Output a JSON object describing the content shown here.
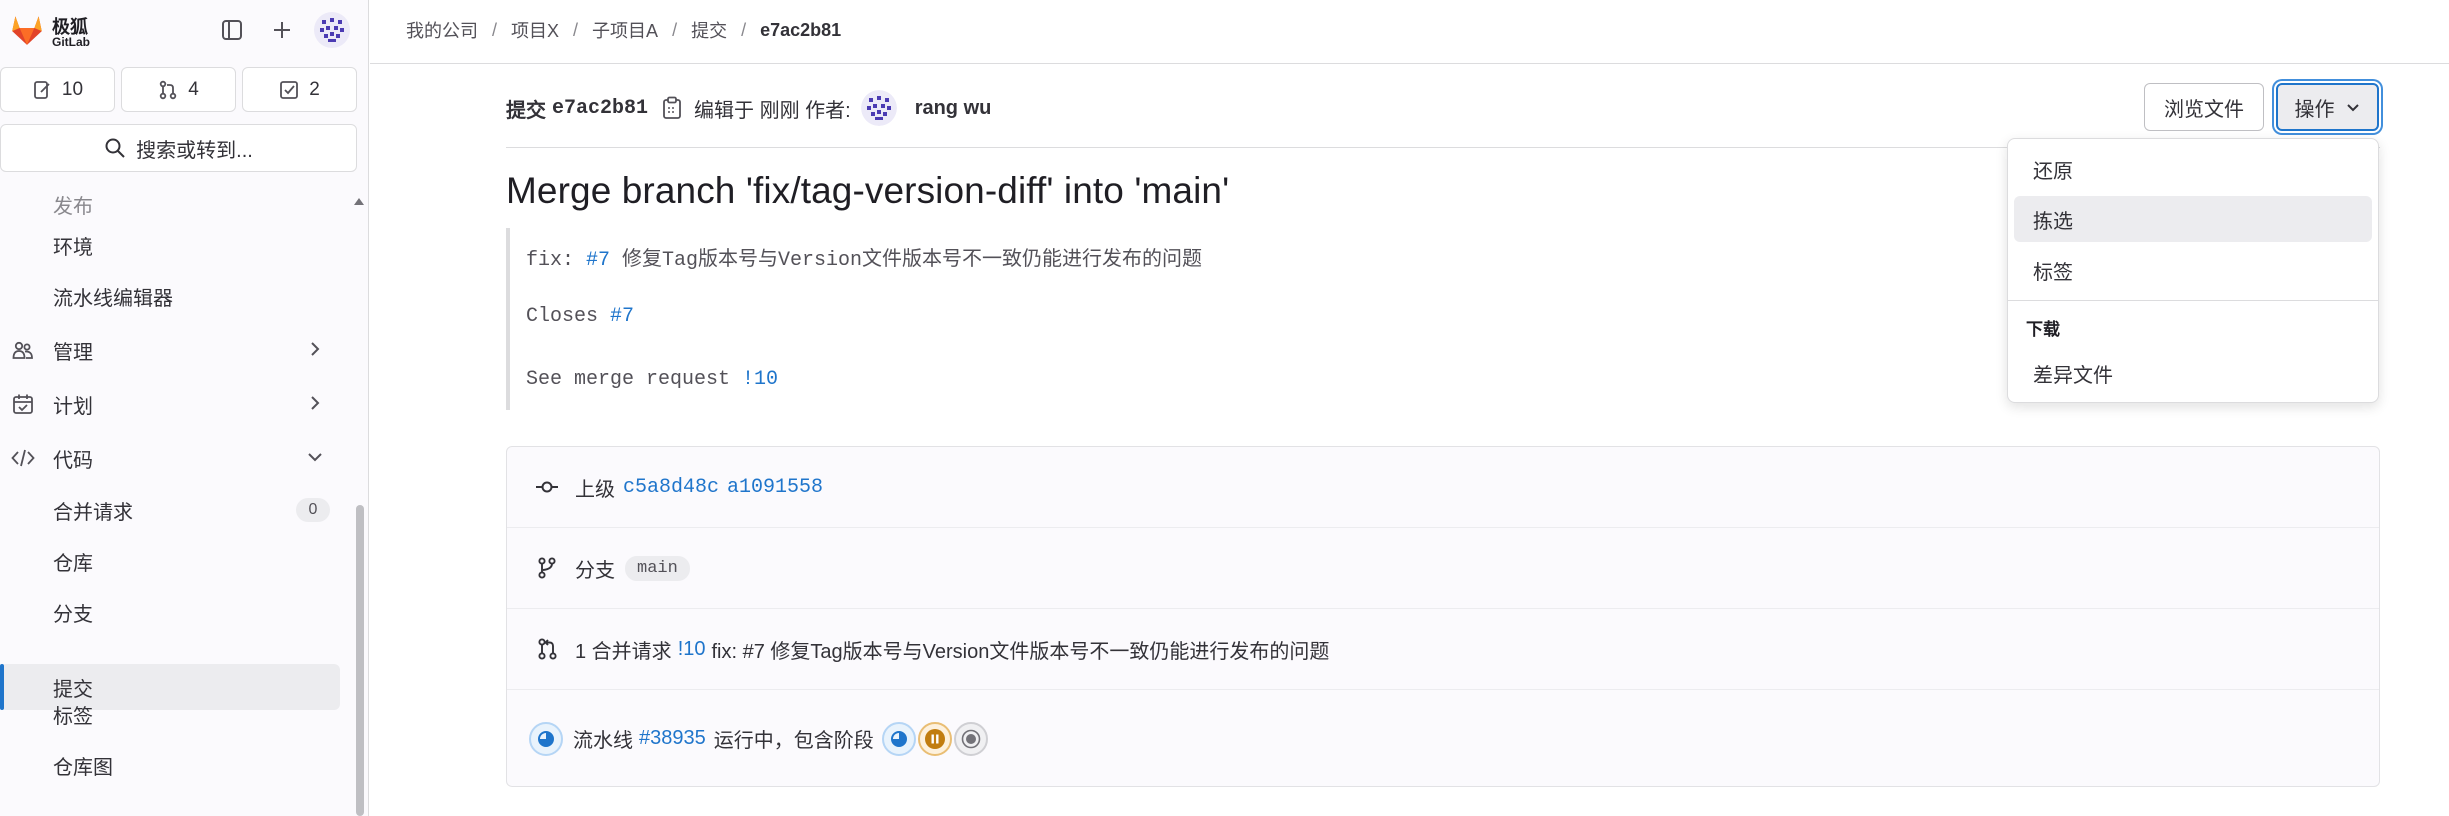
{
  "brand": {
    "name": "极狐",
    "sub": "GitLab"
  },
  "counters": {
    "issues": "10",
    "merge_requests": "4",
    "todos": "2"
  },
  "search": {
    "label": "搜索或转到..."
  },
  "nav": {
    "deploy_partial": "发布",
    "environments": "环境",
    "pipeline_editor": "流水线编辑器",
    "manage": "管理",
    "plan": "计划",
    "code": "代码",
    "code_items": [
      {
        "label": "合并请求",
        "badge": "0"
      },
      {
        "label": "仓库"
      },
      {
        "label": "分支"
      },
      {
        "label": "提交"
      },
      {
        "label": "标签"
      },
      {
        "label": "仓库图"
      }
    ]
  },
  "breadcrumb": [
    "我的公司",
    "项目X",
    "子项目A",
    "提交",
    "e7ac2b81"
  ],
  "commit": {
    "label": "提交",
    "sha": "e7ac2b81",
    "edited_text": "编辑于 刚刚 作者:",
    "author": "rang wu",
    "title": "Merge branch 'fix/tag-version-diff' into 'main'",
    "message": {
      "line1_prefix": "fix: ",
      "line1_ref": "#7",
      "line1_text": " 修复Tag版本号与Version文件版本号不一致仍能进行发布的问题",
      "line2_prefix": "Closes ",
      "line2_ref": "#7",
      "line3_prefix": "See merge request ",
      "line3_ref": "!10"
    }
  },
  "buttons": {
    "browse_files": "浏览文件",
    "operations": "操作"
  },
  "dropdown": {
    "items": [
      "还原",
      "拣选",
      "标签"
    ],
    "group_header": "下载",
    "download_items": [
      "差异文件"
    ]
  },
  "info": {
    "parent_label": "上级",
    "parents": [
      "c5a8d48c",
      "a1091558"
    ],
    "branch_label": "分支",
    "branch": "main",
    "mr_prefix": "1 合并请求",
    "mr_ref": "!10",
    "mr_title": "fix: #7 修复Tag版本号与Version文件版本号不一致仍能进行发布的问题",
    "pipeline_label": "流水线",
    "pipeline_ref": "#38935",
    "pipeline_status": "运行中，包含阶段"
  },
  "colors": {
    "link": "#1f75cb",
    "active_bar": "#1f75cb",
    "stage_running": "#1f75cb",
    "stage_paused": "#c17d10",
    "stage_pending": "#737278"
  }
}
